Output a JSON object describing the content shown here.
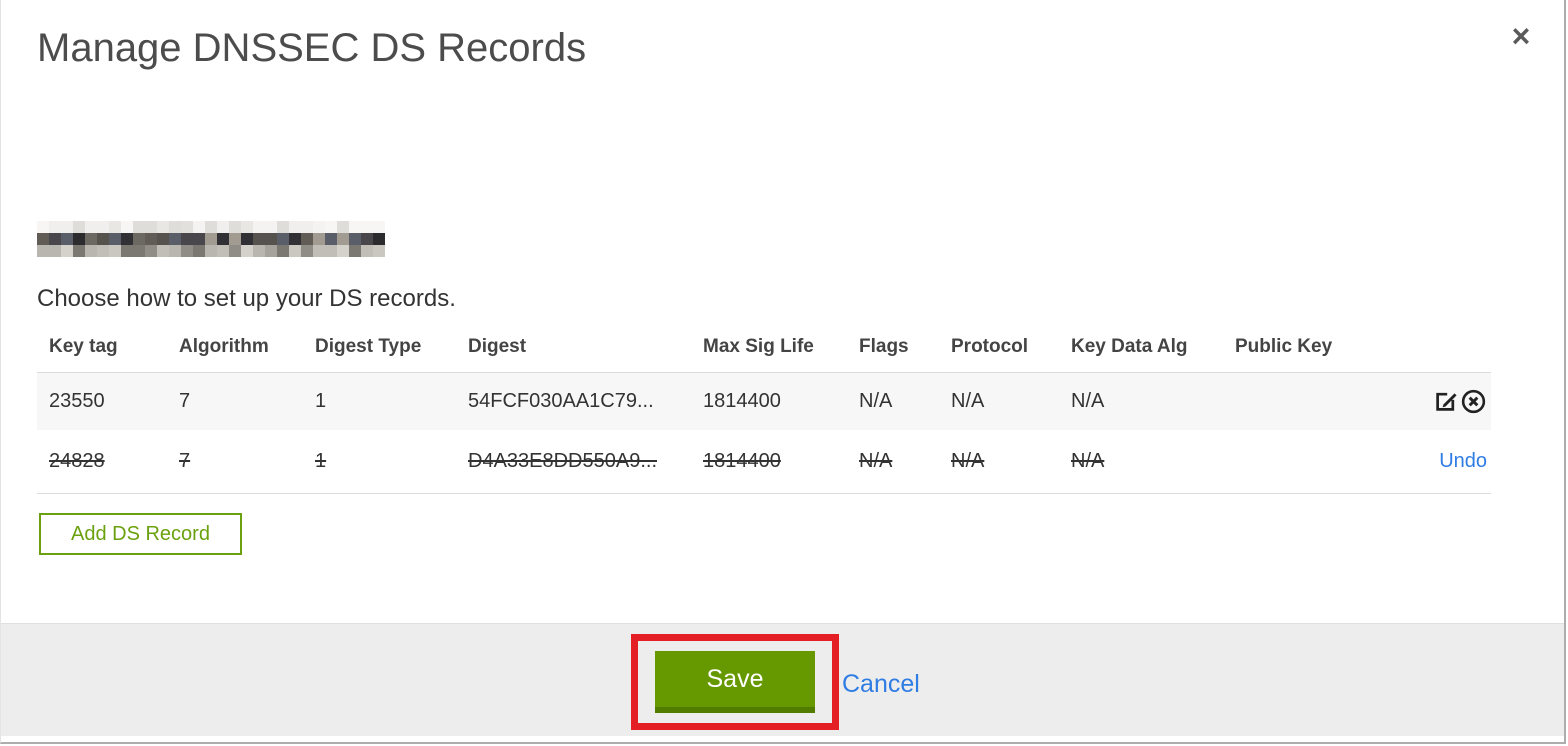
{
  "dialog": {
    "title": "Manage DNSSEC DS Records",
    "subtitle": "Choose how to set up your DS records.",
    "close_glyph": "×"
  },
  "table": {
    "columns": [
      "Key tag",
      "Algorithm",
      "Digest Type",
      "Digest",
      "Max Sig Life",
      "Flags",
      "Protocol",
      "Key Data Alg",
      "Public Key"
    ],
    "rows": [
      {
        "key_tag": "23550",
        "algorithm": "7",
        "digest_type": "1",
        "digest": "54FCF030AA1C79...",
        "max_sig_life": "1814400",
        "flags": "N/A",
        "protocol": "N/A",
        "key_data_alg": "N/A",
        "public_key": "",
        "deleted": false,
        "actions": [
          "edit",
          "delete"
        ]
      },
      {
        "key_tag": "24828",
        "algorithm": "7",
        "digest_type": "1",
        "digest": "D4A33E8DD550A9...",
        "max_sig_life": "1814400",
        "flags": "N/A",
        "protocol": "N/A",
        "key_data_alg": "N/A",
        "public_key": "",
        "deleted": true,
        "actions": [
          "undo"
        ],
        "undo_label": "Undo"
      }
    ]
  },
  "buttons": {
    "add_ds_record": "Add DS Record",
    "save": "Save",
    "cancel": "Cancel"
  },
  "colors": {
    "save_green": "#669900",
    "save_green_dark": "#527c00",
    "add_button_green": "#6ba10e",
    "link_blue": "#2f7ce4",
    "annotation_red": "#e41e25",
    "row_highlight": "#f7f7f7",
    "footer_gray": "#ededed"
  },
  "redacted_domain": {
    "cols": 29,
    "cell": 12,
    "row_palettes": [
      [
        "#f4f3f1",
        "#e9e7e4",
        "#deddd9",
        "#f0efed",
        "#e2e0dc",
        "#f7f6f4"
      ],
      [
        "#3d3c3e",
        "#56524e",
        "#6c6862",
        "#49474b",
        "#313034",
        "#7e7871",
        "#a29b92",
        "#c6bfb5",
        "#5a5e68",
        "#2c2b2d",
        "#615c55"
      ],
      [
        "#b9b5af",
        "#cac6c0",
        "#a6a29c",
        "#d5d1cb",
        "#908d87",
        "#7b7872",
        "#c1bdb7"
      ]
    ]
  }
}
